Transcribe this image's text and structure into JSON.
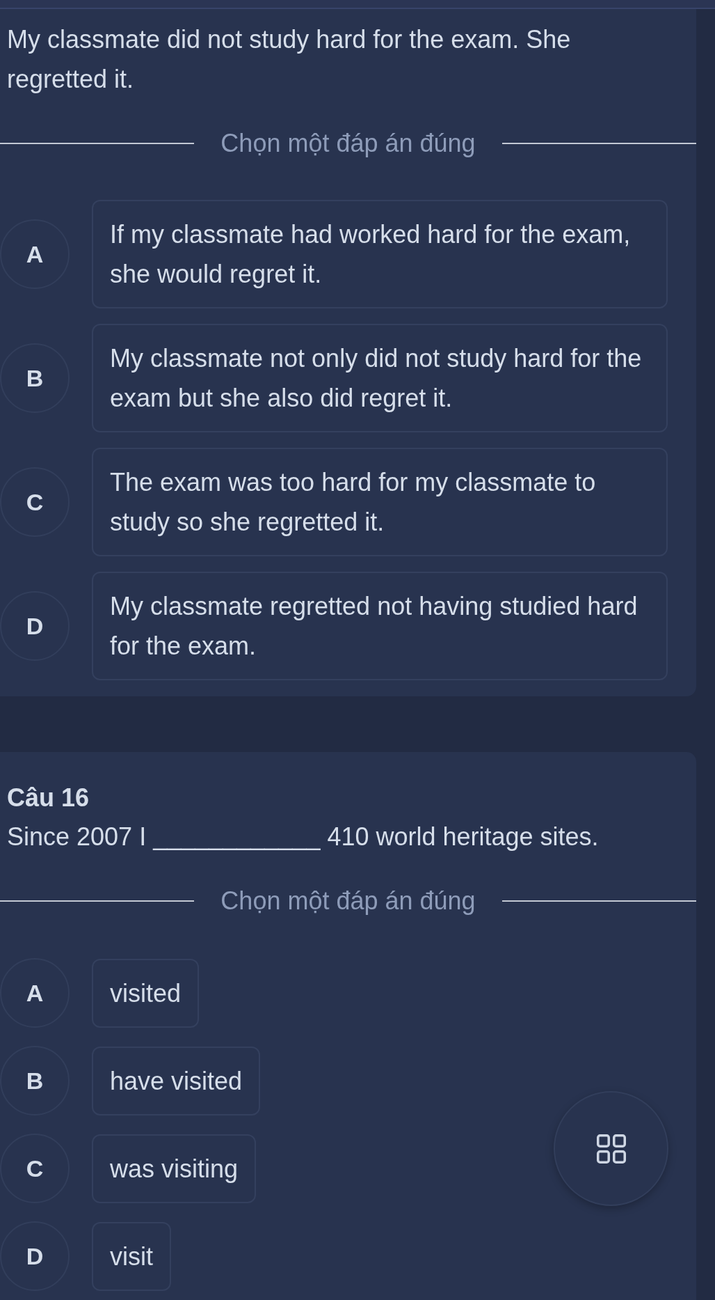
{
  "questions": [
    {
      "text": "My classmate did not study hard for the exam. She regretted it.",
      "prompt": "Chọn một đáp án đúng",
      "options": [
        {
          "letter": "A",
          "text": "If my classmate had worked hard for the exam, she would regret it.",
          "selected": false
        },
        {
          "letter": "B",
          "text": "My classmate not only did not study hard for the exam but she also did regret it.",
          "selected": false
        },
        {
          "letter": "C",
          "text": "The exam was too hard for my classmate to study so she regretted it.",
          "selected": false
        },
        {
          "letter": "D",
          "text": "My classmate regretted not having studied hard for the exam.",
          "selected": false
        }
      ]
    },
    {
      "title": "Câu 16",
      "text": "Since 2007 I ____________ 410 world heritage sites.",
      "prompt": "Chọn một đáp án đúng",
      "options": [
        {
          "letter": "A",
          "text": "visited",
          "selected": false
        },
        {
          "letter": "B",
          "text": "have visited",
          "selected": false
        },
        {
          "letter": "C",
          "text": "was visiting",
          "selected": false
        },
        {
          "letter": "D",
          "text": "visit",
          "selected": false
        }
      ]
    }
  ]
}
